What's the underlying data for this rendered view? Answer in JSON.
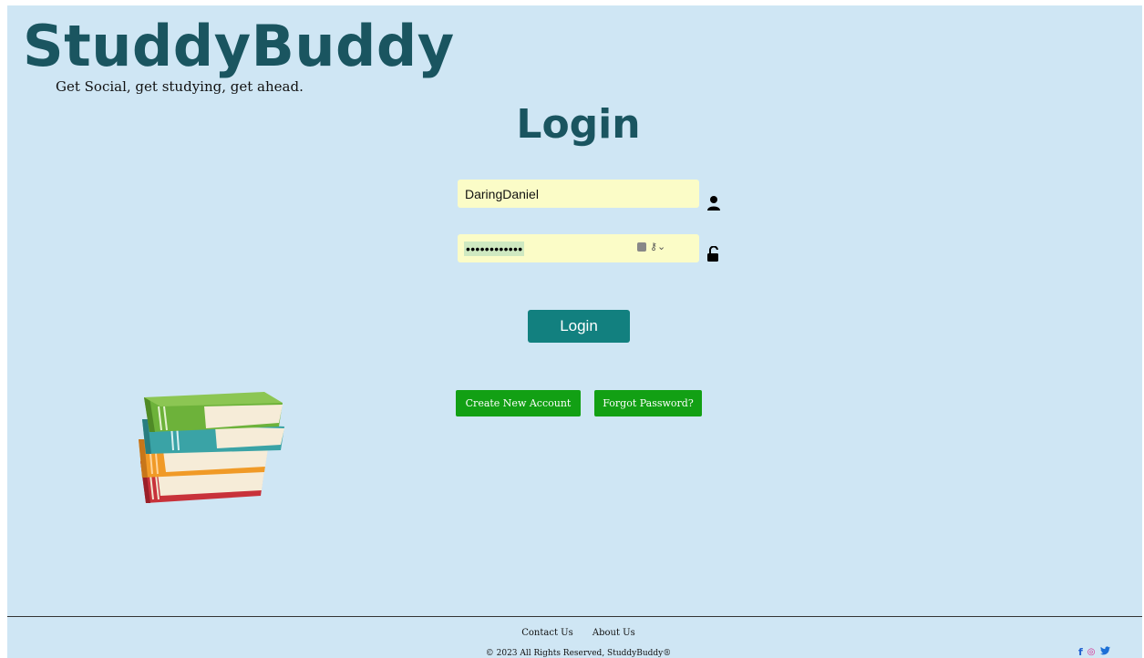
{
  "brand": {
    "name": "StuddyBuddy",
    "tagline": "Get Social, get studying, get ahead."
  },
  "login": {
    "title": "Login",
    "username_value": "DaringDaniel",
    "password_masked": "••••••••••••",
    "submit_label": "Login"
  },
  "actions": {
    "create_account_label": "Create New Account",
    "forgot_password_label": "Forgot Password?"
  },
  "footer": {
    "contact_label": "Contact Us",
    "about_label": "About Us",
    "copyright": "© 2023 All Rights Reserved, StuddyBuddy®",
    "social": [
      {
        "name": "facebook-icon",
        "glyph": "f"
      },
      {
        "name": "instagram-icon",
        "glyph": "◎"
      },
      {
        "name": "twitter-icon",
        "glyph": "🐦"
      }
    ]
  },
  "colors": {
    "background": "#cfe6f4",
    "brand": "#1a5560",
    "primary_button": "#12807f",
    "secondary_button": "#12a014",
    "input_fill": "#fbfcc7"
  }
}
